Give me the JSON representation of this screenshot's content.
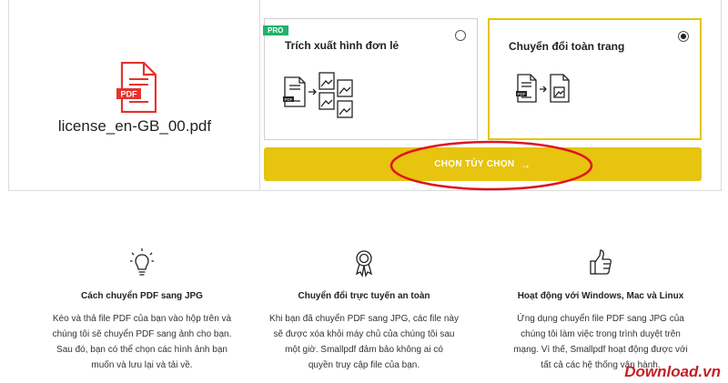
{
  "file": {
    "name": "license_en-GB_00.pdf",
    "badge": "PDF"
  },
  "options": [
    {
      "title": "Trích xuất hình đơn lẻ",
      "badge": "PRO",
      "selected": false,
      "icon": "pdf-to-multiple-images"
    },
    {
      "title": "Chuyển đổi toàn trang",
      "selected": true,
      "icon": "pdf-to-single-image"
    }
  ],
  "choose_button": {
    "label": "CHỌN TÙY CHỌN",
    "arrow": "→"
  },
  "features": [
    {
      "icon": "lightbulb-icon",
      "title": "Cách chuyển PDF sang JPG",
      "lines": [
        "Kéo và thả file PDF của bạn vào hộp trên và",
        "chúng tôi sẽ chuyển PDF sang ảnh cho bạn.",
        "Sau đó, bạn có thể chọn các hình ảnh bạn",
        "muốn và lưu lại và tải về."
      ]
    },
    {
      "icon": "award-ribbon-icon",
      "title": "Chuyển đổi trực tuyến an toàn",
      "lines": [
        "Khi bạn đã chuyển PDF sang JPG, các file này",
        "sẽ được xóa khỏi máy chủ của chúng tôi sau",
        "một giờ. Smallpdf đảm bảo không ai có",
        "quyền truy cập file của bạn."
      ]
    },
    {
      "icon": "thumbs-up-icon",
      "title": "Hoạt động với Windows, Mac và Linux",
      "lines": [
        "Ứng dụng chuyển file PDF sang JPG của",
        "chúng tôi làm việc trong trình duyệt trên",
        "mạng. Vì thế, Smallpdf hoạt động được với",
        "tất cả các hệ thống vận hành."
      ]
    }
  ],
  "watermark": "Download.vn",
  "colors": {
    "accent": "#e6c40f",
    "pdf_red": "#e5322d",
    "pro_green": "#1fb36b",
    "highlight": "#e0141e"
  }
}
